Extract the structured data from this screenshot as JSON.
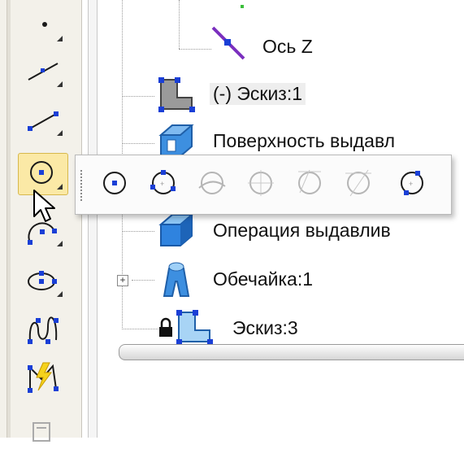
{
  "tree": {
    "items": [
      {
        "label": "Ось Z",
        "icon": "axis-icon"
      },
      {
        "label": "(-) Эскиз:1",
        "icon": "sketch-icon"
      },
      {
        "label": "Поверхность выдавл",
        "icon": "extrude-surface-icon"
      },
      {
        "label": "Операция выдавлив",
        "icon": "extrude-operation-icon"
      },
      {
        "label": "Обечайка:1",
        "icon": "shell-icon"
      },
      {
        "label": "Эскиз:3",
        "icon": "sketch-icon"
      }
    ],
    "expander_symbol": "+"
  },
  "toolbar": {
    "buttons": [
      "point-icon",
      "line-icon",
      "segment-icon",
      "circle-icon",
      "arc-icon",
      "ellipse-icon",
      "spline-icon",
      "auto-line-icon",
      "dimension-icon"
    ],
    "active": "circle-icon"
  },
  "flyout": {
    "buttons": [
      {
        "icon": "circle-center-icon",
        "enabled": true
      },
      {
        "icon": "circle-three-points-icon",
        "enabled": true
      },
      {
        "icon": "circle-tangent-curve-icon",
        "enabled": false
      },
      {
        "icon": "circle-tangent-two-icon",
        "enabled": false
      },
      {
        "icon": "circle-tangent-three-icon",
        "enabled": false
      },
      {
        "icon": "circle-tangent-alt-icon",
        "enabled": false
      },
      {
        "icon": "circle-two-points-icon",
        "enabled": true
      }
    ]
  },
  "colors": {
    "accent_blue": "#1a3fd6",
    "active_highlight": "#fbe9a6",
    "axis_purple": "#7b2fbe",
    "solid_blue": "#3d8fe0"
  }
}
